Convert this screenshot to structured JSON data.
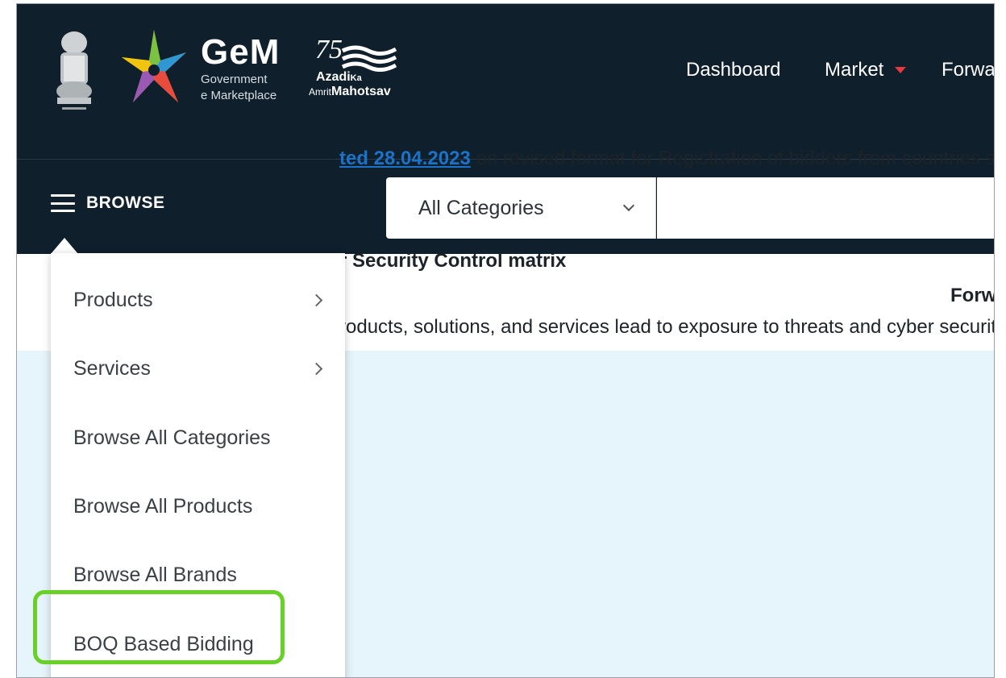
{
  "header": {
    "logo_title": "GeM",
    "logo_subtitle_1": "Government",
    "logo_subtitle_2": "e Marketplace",
    "azadi_number": "75",
    "azadi_line_1": "Azadi",
    "azadi_ka": "Ka",
    "azadi_line_2_prefix": "Amrit",
    "azadi_line_2": "Mahotsav",
    "nav": {
      "dashboard": "Dashboard",
      "market": "Market",
      "forward": "Forwa"
    }
  },
  "search": {
    "browse_label": "BROWSE",
    "category_value": "All Categories",
    "query_value": ""
  },
  "browse_menu": {
    "items": [
      {
        "label": "Products",
        "has_submenu": true
      },
      {
        "label": "Services",
        "has_submenu": true
      },
      {
        "label": "Browse All Categories",
        "has_submenu": false
      },
      {
        "label": "Browse All Products",
        "has_submenu": false
      },
      {
        "label": "Browse All Brands",
        "has_submenu": false
      },
      {
        "label": "BOQ Based Bidding",
        "has_submenu": false
      }
    ],
    "highlighted_item": "BOQ Based Bidding",
    "highlight_color": "#67d126"
  },
  "page": {
    "right_heading": "Forw",
    "notice_link": "ted 28.04.2023",
    "notice_line_1_rest": " on revised format for Registration of bidders from countries s",
    "notice_line_2": "r Security Control matrix",
    "notice_line_3": "roducts, solutions, and services lead to exposure to threats and cyber security"
  },
  "colors": {
    "header_bg": "#0f1f2b",
    "notice_bg": "#e6f4fb",
    "link": "#1a73c8",
    "market_caret": "#e8383d"
  }
}
